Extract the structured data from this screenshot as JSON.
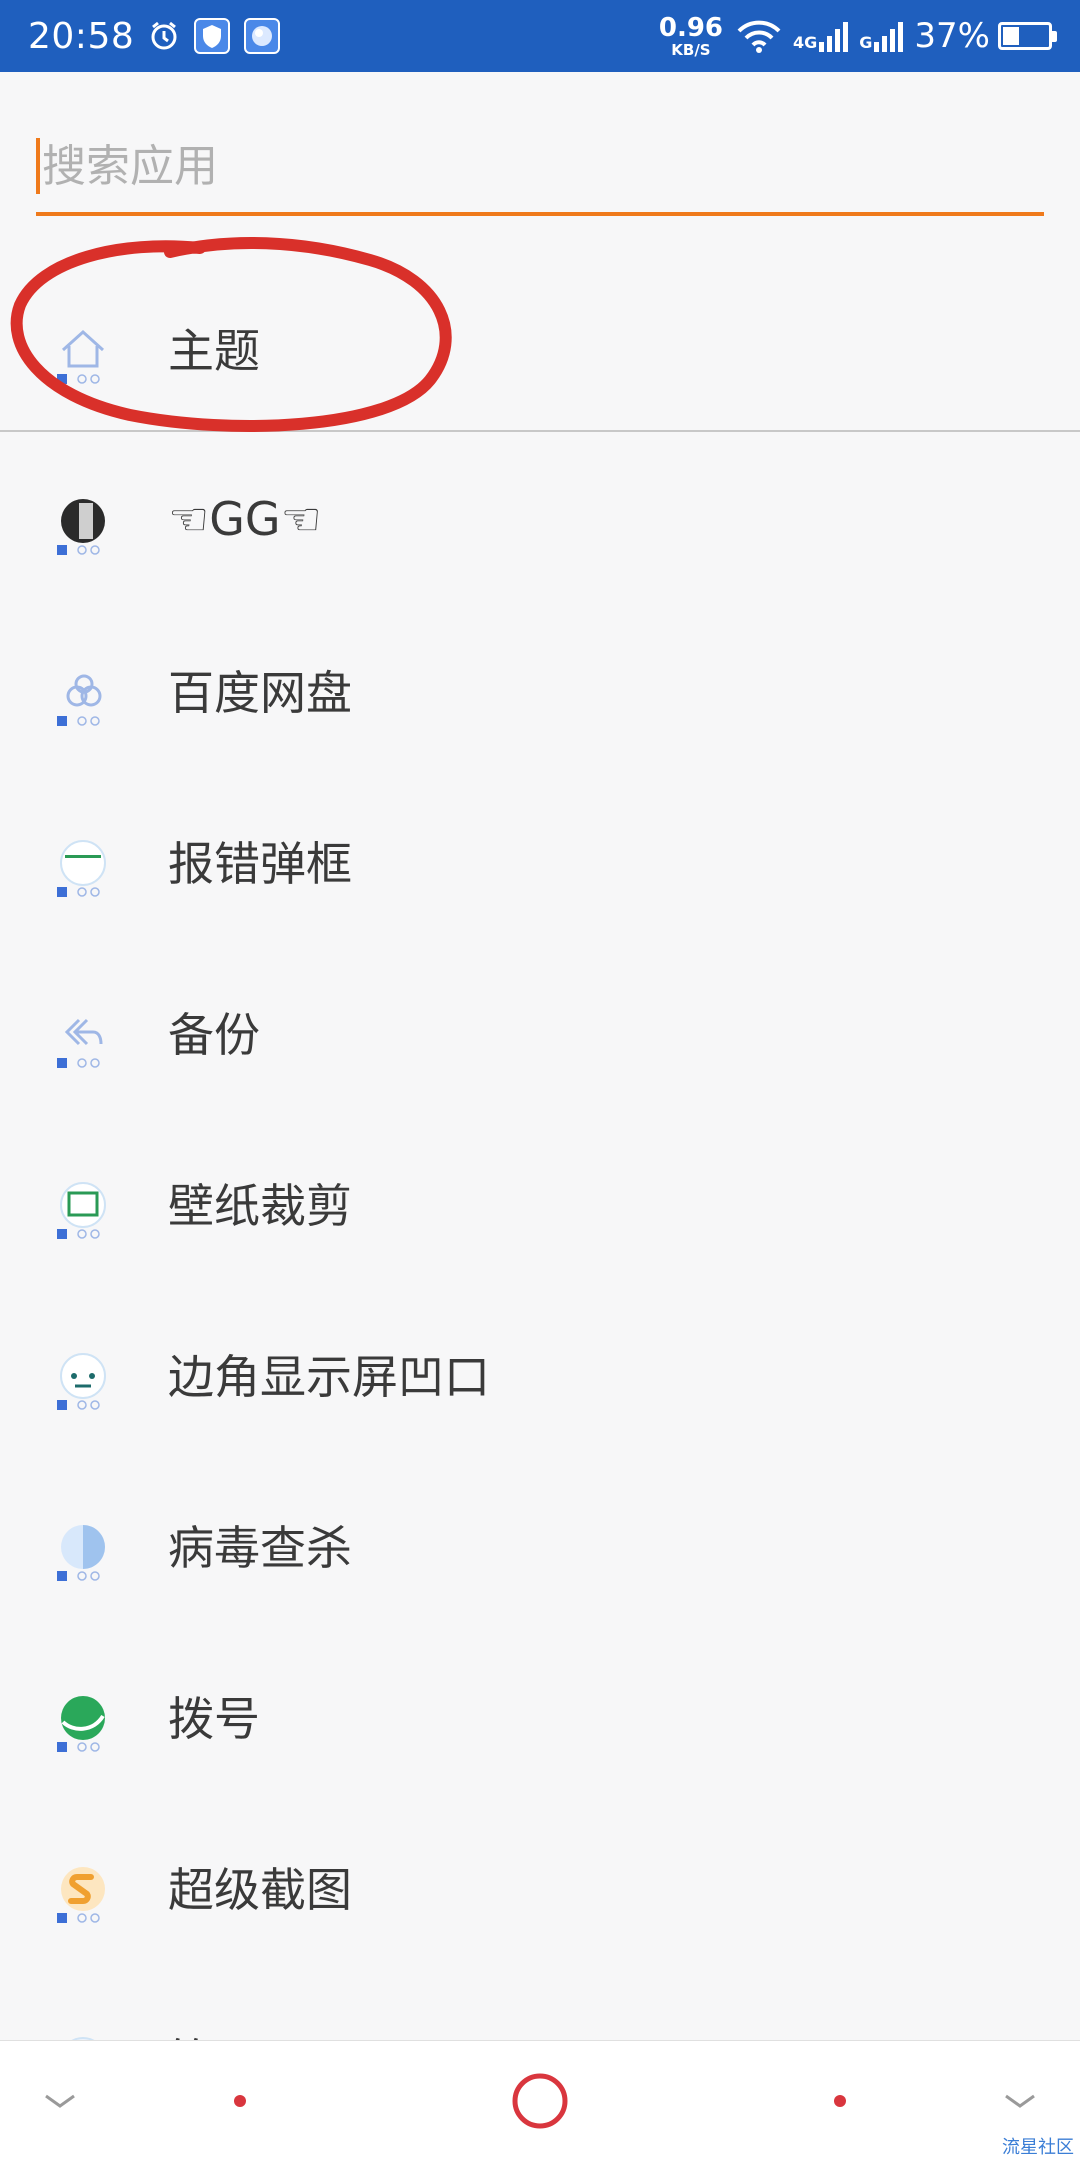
{
  "status_bar": {
    "time": "20:58",
    "net_speed": "0.96",
    "net_unit": "KB/S",
    "signal1_label": "4G",
    "signal2_label": "G",
    "battery": "37%",
    "icons": [
      "alarm-icon",
      "shield-app-icon",
      "ball-app-icon",
      "wifi-icon",
      "signal-icon",
      "battery-icon"
    ]
  },
  "search": {
    "placeholder": "搜索应用",
    "value": ""
  },
  "apps": [
    {
      "label": "主题",
      "icon": "home-icon",
      "color": "#9fb7e6"
    },
    {
      "label": "☜GG☜",
      "icon": "gg-avatar-icon",
      "color": "#555"
    },
    {
      "label": "百度网盘",
      "icon": "cloud-icon",
      "color": "#9fb7e6"
    },
    {
      "label": "报错弹框",
      "icon": "dialog-icon",
      "color": "#2a9a55"
    },
    {
      "label": "备份",
      "icon": "backup-icon",
      "color": "#9fb7e6"
    },
    {
      "label": "壁纸裁剪",
      "icon": "crop-icon",
      "color": "#2a9a55"
    },
    {
      "label": "边角显示屏凹口",
      "icon": "notch-icon",
      "color": "#1d6b6b"
    },
    {
      "label": "病毒查杀",
      "icon": "virus-scan-icon",
      "color": "#9fc3ee"
    },
    {
      "label": "拨号",
      "icon": "phone-icon",
      "color": "#2aa85a"
    },
    {
      "label": "超级截图",
      "icon": "screenshot-icon",
      "color": "#f0a030"
    },
    {
      "label": "笔录器",
      "icon": "app-icon",
      "color": "#9fb7e6"
    }
  ],
  "nav": {
    "buttons": [
      "down-left-icon",
      "dot-left-icon",
      "home-circle-icon",
      "dot-right-icon",
      "down-right-icon"
    ],
    "accent": "#d9363e"
  },
  "watermark": "流星社区"
}
